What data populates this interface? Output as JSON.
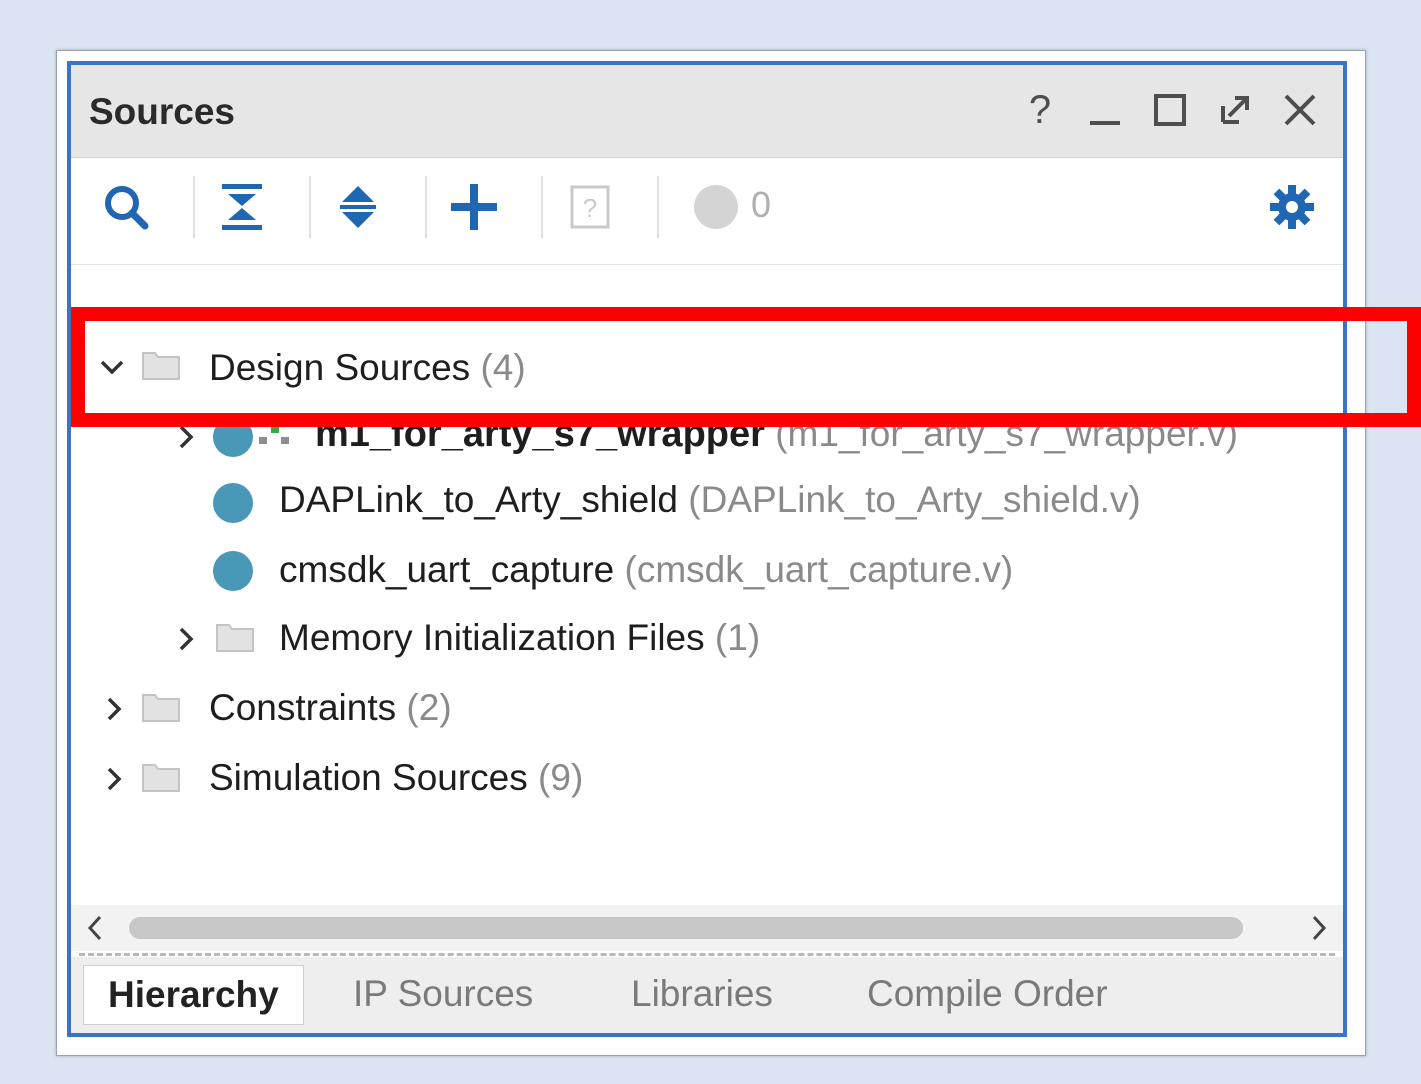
{
  "panel": {
    "title": "Sources",
    "window_buttons": {
      "help": "?",
      "minimize": "_",
      "maximize": "☐",
      "float": "⇱",
      "close": "✕"
    }
  },
  "toolbar": {
    "messages_count": "0",
    "icons": [
      "search-icon",
      "collapse-all-icon",
      "expand-all-icon",
      "add-icon",
      "unknown-file-icon",
      "messages-icon",
      "gear-icon"
    ]
  },
  "tree": {
    "design_sources": {
      "label": "Design Sources",
      "count": "(4)"
    },
    "wrapper": {
      "name": "m1_for_arty_s7_wrapper",
      "file": "(m1_for_arty_s7_wrapper.v)"
    },
    "daplink": {
      "name": "DAPLink_to_Arty_shield",
      "file": "(DAPLink_to_Arty_shield.v)"
    },
    "uart": {
      "name": "cmsdk_uart_capture",
      "file": "(cmsdk_uart_capture.v)"
    },
    "mem_init": {
      "label": "Memory Initialization Files",
      "count": "(1)"
    },
    "constraints": {
      "label": "Constraints",
      "count": "(2)"
    },
    "simulation": {
      "label": "Simulation Sources",
      "count": "(9)"
    }
  },
  "tabs": [
    {
      "label": "Hierarchy",
      "active": true
    },
    {
      "label": "IP Sources",
      "active": false
    },
    {
      "label": "Libraries",
      "active": false
    },
    {
      "label": "Compile Order",
      "active": false
    }
  ],
  "colors": {
    "accent_border": "#3b73c7",
    "highlight": "#ff0000",
    "module_dot": "#4a98b8",
    "gear": "#1f66b3"
  }
}
